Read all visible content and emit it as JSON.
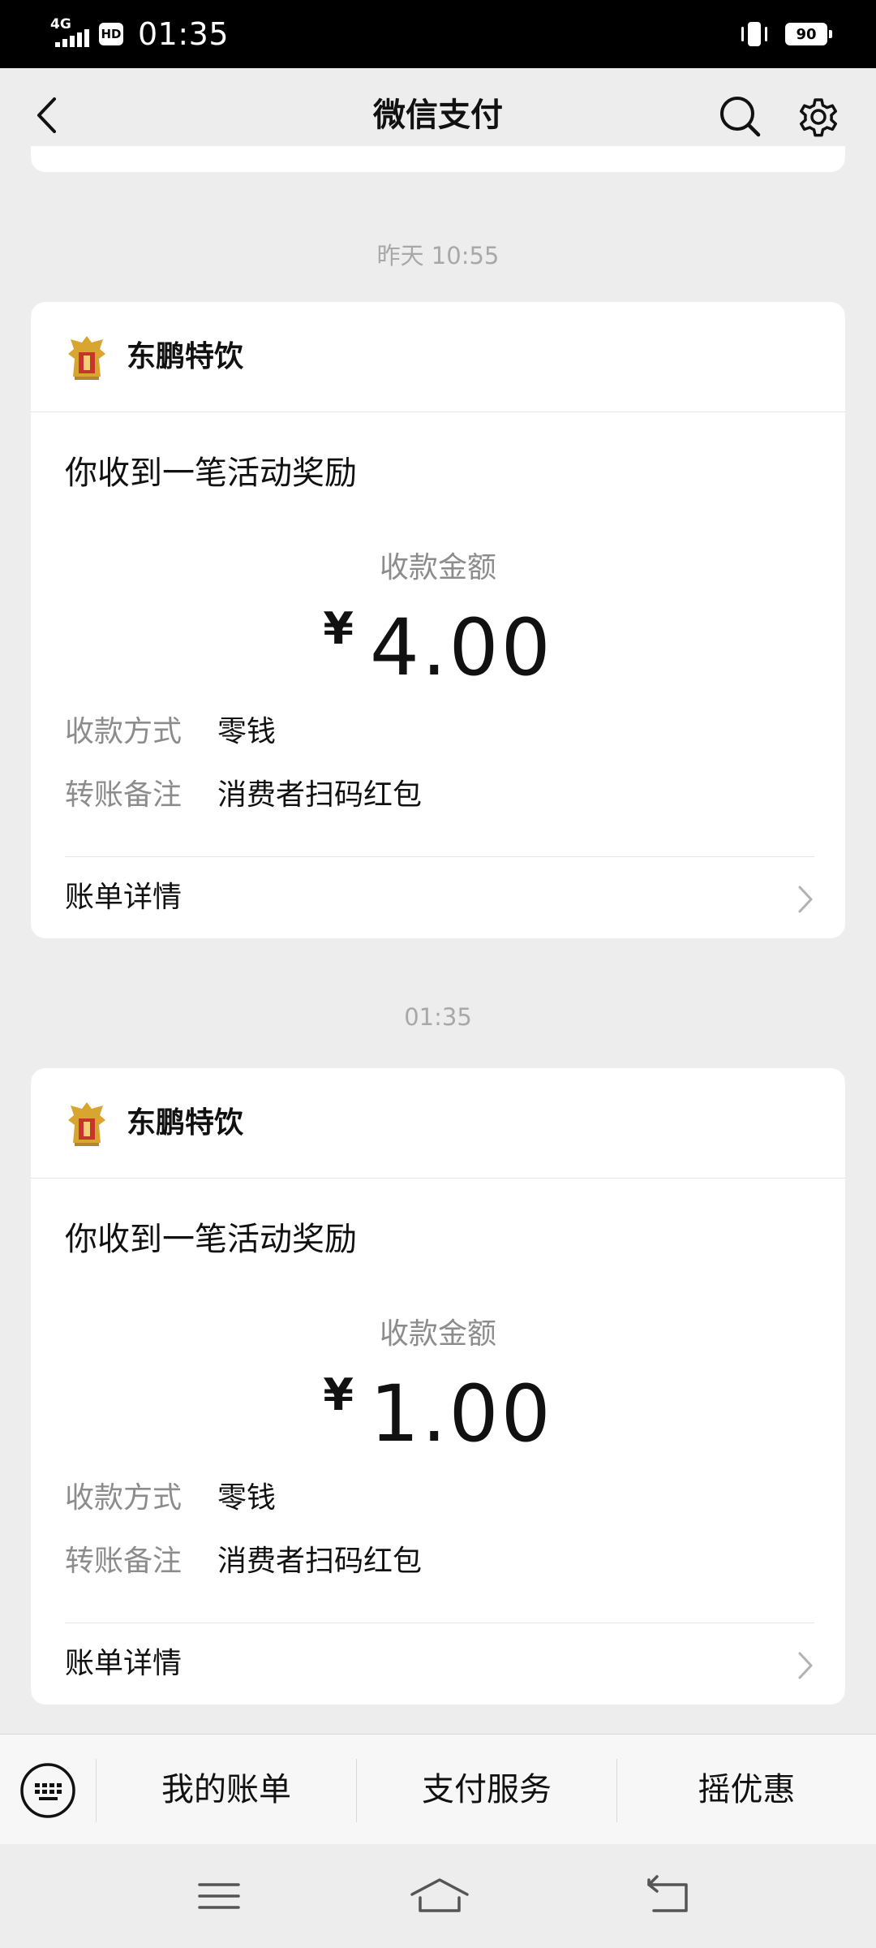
{
  "status_bar": {
    "network": "4G",
    "hd": "HD",
    "time": "01:35",
    "battery": "90"
  },
  "nav": {
    "title": "微信支付"
  },
  "messages": [
    {
      "timestamp": "昨天 10:55",
      "merchant": "东鹏特饮",
      "title": "你收到一笔活动奖励",
      "amount_label": "收款金额",
      "currency": "¥",
      "amount": "4.00",
      "method_label": "收款方式",
      "method_value": "零钱",
      "note_label": "转账备注",
      "note_value": "消费者扫码红包",
      "detail_label": "账单详情"
    },
    {
      "timestamp": "01:35",
      "merchant": "东鹏特饮",
      "title": "你收到一笔活动奖励",
      "amount_label": "收款金额",
      "currency": "¥",
      "amount": "1.00",
      "method_label": "收款方式",
      "method_value": "零钱",
      "note_label": "转账备注",
      "note_value": "消费者扫码红包",
      "detail_label": "账单详情"
    }
  ],
  "menu": {
    "items": [
      "我的账单",
      "支付服务",
      "摇优惠"
    ]
  },
  "colors": {
    "background": "#ededed",
    "card": "#ffffff",
    "muted_text": "#8c8c8c",
    "timestamp_text": "#a8a8a8"
  }
}
